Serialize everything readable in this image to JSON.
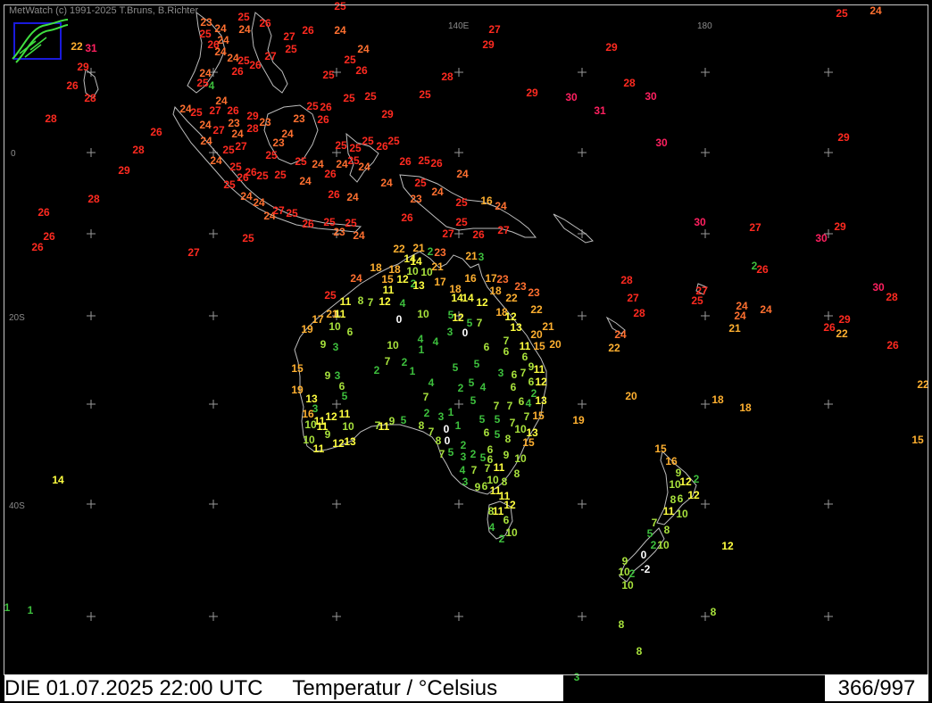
{
  "credit": "MetWatch  (c) 1991-2025 T.Bruns, B.Richter",
  "status": {
    "datetime": "DIE 01.07.2025 22:00 UTC",
    "parameter": "Temperatur / °Celsius",
    "counter": "366/997"
  },
  "graticule_labels": {
    "lon_140": "140E",
    "lon_180": "180",
    "lat_0": "0",
    "lat_20": "20S",
    "lat_40": "40S"
  },
  "colors": {
    "background": "#000000",
    "coast": "#bdbdbd",
    "scale": [
      "#ffffff",
      "#3dbf3d",
      "#a8e23c",
      "#ffff40",
      "#ffb030",
      "#ff7030",
      "#ff2a20",
      "#ff2060"
    ]
  },
  "observations": [
    [
      943,
      15,
      25
    ],
    [
      981,
      12,
      24
    ],
    [
      554,
      33,
      27
    ],
    [
      547,
      50,
      29
    ],
    [
      685,
      53,
      29
    ],
    [
      501,
      86,
      28
    ],
    [
      705,
      93,
      28
    ],
    [
      596,
      104,
      29
    ],
    [
      640,
      109,
      30
    ],
    [
      729,
      108,
      30
    ],
    [
      476,
      106,
      25
    ],
    [
      672,
      124,
      31
    ],
    [
      741,
      160,
      30
    ],
    [
      945,
      154,
      29
    ],
    [
      784,
      249,
      30
    ],
    [
      846,
      255,
      27
    ],
    [
      941,
      254,
      29
    ],
    [
      920,
      267,
      30
    ],
    [
      86,
      52,
      22
    ],
    [
      102,
      54,
      31
    ],
    [
      93,
      75,
      29
    ],
    [
      81,
      96,
      26
    ],
    [
      101,
      110,
      28
    ],
    [
      57,
      133,
      28
    ],
    [
      175,
      148,
      26
    ],
    [
      155,
      168,
      28
    ],
    [
      139,
      191,
      29
    ],
    [
      105,
      223,
      28
    ],
    [
      49,
      238,
      26
    ],
    [
      55,
      265,
      26
    ],
    [
      42,
      277,
      26
    ],
    [
      217,
      283,
      27
    ],
    [
      278,
      267,
      25
    ],
    [
      231,
      25,
      23
    ],
    [
      247,
      32,
      24
    ],
    [
      273,
      19,
      25
    ],
    [
      230,
      38,
      25
    ],
    [
      250,
      45,
      24
    ],
    [
      274,
      33,
      24
    ],
    [
      297,
      26,
      26
    ],
    [
      324,
      41,
      27
    ],
    [
      345,
      34,
      26
    ],
    [
      381,
      34,
      24
    ],
    [
      239,
      50,
      26
    ],
    [
      247,
      58,
      24
    ],
    [
      261,
      65,
      24
    ],
    [
      273,
      68,
      25
    ],
    [
      286,
      73,
      26
    ],
    [
      303,
      63,
      27
    ],
    [
      326,
      55,
      25
    ],
    [
      266,
      80,
      26
    ],
    [
      230,
      82,
      24
    ],
    [
      227,
      93,
      25
    ],
    [
      237,
      96,
      4
    ],
    [
      381,
      7,
      25
    ],
    [
      392,
      67,
      25
    ],
    [
      405,
      79,
      26
    ],
    [
      368,
      84,
      25
    ],
    [
      407,
      55,
      24
    ],
    [
      391,
      110,
      25
    ],
    [
      415,
      108,
      25
    ],
    [
      248,
      113,
      24
    ],
    [
      208,
      122,
      24
    ],
    [
      220,
      126,
      25
    ],
    [
      241,
      124,
      27
    ],
    [
      261,
      124,
      26
    ],
    [
      230,
      140,
      24
    ],
    [
      245,
      146,
      27
    ],
    [
      262,
      138,
      23
    ],
    [
      283,
      130,
      29
    ],
    [
      297,
      137,
      23
    ],
    [
      266,
      150,
      24
    ],
    [
      283,
      144,
      28
    ],
    [
      322,
      150,
      24
    ],
    [
      335,
      133,
      23
    ],
    [
      350,
      119,
      25
    ],
    [
      365,
      120,
      26
    ],
    [
      362,
      134,
      26
    ],
    [
      434,
      128,
      29
    ],
    [
      231,
      158,
      24
    ],
    [
      312,
      160,
      23
    ],
    [
      256,
      168,
      25
    ],
    [
      270,
      164,
      27
    ],
    [
      304,
      174,
      25
    ],
    [
      242,
      180,
      24
    ],
    [
      264,
      187,
      25
    ],
    [
      281,
      193,
      26
    ],
    [
      294,
      197,
      25
    ],
    [
      272,
      199,
      26
    ],
    [
      314,
      196,
      25
    ],
    [
      337,
      181,
      25
    ],
    [
      356,
      184,
      24
    ],
    [
      382,
      163,
      25
    ],
    [
      398,
      166,
      25
    ],
    [
      412,
      158,
      25
    ],
    [
      428,
      164,
      26
    ],
    [
      441,
      158,
      25
    ],
    [
      383,
      184,
      24
    ],
    [
      396,
      180,
      25
    ],
    [
      408,
      187,
      24
    ],
    [
      454,
      181,
      26
    ],
    [
      475,
      180,
      25
    ],
    [
      489,
      183,
      26
    ],
    [
      518,
      195,
      24
    ],
    [
      257,
      207,
      25
    ],
    [
      370,
      195,
      26
    ],
    [
      342,
      203,
      24
    ],
    [
      395,
      221,
      24
    ],
    [
      374,
      218,
      26
    ],
    [
      276,
      220,
      24
    ],
    [
      290,
      227,
      24
    ],
    [
      302,
      242,
      24
    ],
    [
      312,
      236,
      27
    ],
    [
      327,
      239,
      25
    ],
    [
      345,
      251,
      26
    ],
    [
      369,
      249,
      25
    ],
    [
      393,
      250,
      25
    ],
    [
      380,
      260,
      23
    ],
    [
      402,
      264,
      24
    ],
    [
      433,
      205,
      24
    ],
    [
      471,
      205,
      25
    ],
    [
      466,
      223,
      23
    ],
    [
      490,
      215,
      24
    ],
    [
      517,
      227,
      25
    ],
    [
      545,
      225,
      16
    ],
    [
      561,
      231,
      24
    ],
    [
      456,
      244,
      26
    ],
    [
      517,
      249,
      25
    ],
    [
      502,
      262,
      27
    ],
    [
      536,
      263,
      26
    ],
    [
      564,
      258,
      27
    ],
    [
      447,
      279,
      22
    ],
    [
      469,
      278,
      21
    ],
    [
      482,
      282,
      2
    ],
    [
      493,
      283,
      23
    ],
    [
      459,
      290,
      14
    ],
    [
      466,
      293,
      14
    ],
    [
      528,
      287,
      21
    ],
    [
      539,
      288,
      3
    ],
    [
      421,
      300,
      18
    ],
    [
      442,
      302,
      18
    ],
    [
      462,
      304,
      10
    ],
    [
      478,
      305,
      10
    ],
    [
      490,
      299,
      21
    ],
    [
      434,
      313,
      15
    ],
    [
      451,
      313,
      12
    ],
    [
      463,
      318,
      2
    ],
    [
      469,
      320,
      13
    ],
    [
      493,
      316,
      17
    ],
    [
      527,
      312,
      16
    ],
    [
      550,
      312,
      17
    ],
    [
      563,
      313,
      23
    ],
    [
      583,
      321,
      23
    ],
    [
      598,
      328,
      23
    ],
    [
      555,
      326,
      18
    ],
    [
      573,
      334,
      22
    ],
    [
      399,
      312,
      24
    ],
    [
      435,
      325,
      11
    ],
    [
      510,
      324,
      18
    ],
    [
      512,
      334,
      14
    ],
    [
      524,
      334,
      14
    ],
    [
      540,
      339,
      12
    ],
    [
      562,
      350,
      18
    ],
    [
      572,
      355,
      12
    ],
    [
      601,
      347,
      22
    ],
    [
      370,
      331,
      25
    ],
    [
      387,
      338,
      11
    ],
    [
      404,
      337,
      8
    ],
    [
      415,
      339,
      7
    ],
    [
      431,
      338,
      12
    ],
    [
      451,
      340,
      4
    ],
    [
      513,
      356,
      12
    ],
    [
      526,
      362,
      5
    ],
    [
      537,
      362,
      7
    ],
    [
      356,
      358,
      17
    ],
    [
      372,
      352,
      21
    ],
    [
      381,
      352,
      11
    ],
    [
      375,
      366,
      10
    ],
    [
      392,
      372,
      6
    ],
    [
      447,
      358,
      0
    ],
    [
      474,
      352,
      10
    ],
    [
      505,
      353,
      5
    ],
    [
      578,
      367,
      13
    ],
    [
      614,
      366,
      21
    ],
    [
      601,
      375,
      20
    ],
    [
      622,
      386,
      20
    ],
    [
      344,
      369,
      19
    ],
    [
      362,
      386,
      9
    ],
    [
      376,
      389,
      3
    ],
    [
      440,
      387,
      10
    ],
    [
      471,
      380,
      4
    ],
    [
      472,
      392,
      1
    ],
    [
      488,
      383,
      4
    ],
    [
      504,
      372,
      3
    ],
    [
      521,
      373,
      0
    ],
    [
      545,
      389,
      6
    ],
    [
      567,
      382,
      7
    ],
    [
      567,
      394,
      6
    ],
    [
      588,
      388,
      11
    ],
    [
      588,
      400,
      6
    ],
    [
      604,
      388,
      15
    ],
    [
      333,
      413,
      15
    ],
    [
      367,
      421,
      9
    ],
    [
      378,
      421,
      3
    ],
    [
      383,
      433,
      6
    ],
    [
      386,
      444,
      5
    ],
    [
      422,
      415,
      2
    ],
    [
      434,
      405,
      7
    ],
    [
      453,
      406,
      2
    ],
    [
      462,
      416,
      1
    ],
    [
      510,
      412,
      5
    ],
    [
      534,
      408,
      5
    ],
    [
      561,
      418,
      3
    ],
    [
      576,
      420,
      6
    ],
    [
      586,
      418,
      7
    ],
    [
      595,
      411,
      9
    ],
    [
      604,
      414,
      11
    ],
    [
      595,
      428,
      6
    ],
    [
      606,
      428,
      12
    ],
    [
      575,
      434,
      6
    ],
    [
      333,
      437,
      19
    ],
    [
      483,
      429,
      4
    ],
    [
      477,
      445,
      7
    ],
    [
      516,
      435,
      2
    ],
    [
      528,
      429,
      5
    ],
    [
      541,
      434,
      4
    ],
    [
      584,
      450,
      6
    ],
    [
      592,
      452,
      4
    ],
    [
      598,
      441,
      2
    ],
    [
      606,
      449,
      13
    ],
    [
      648,
      471,
      19
    ],
    [
      707,
      444,
      20
    ],
    [
      804,
      448,
      18
    ],
    [
      835,
      457,
      18
    ],
    [
      349,
      447,
      13
    ],
    [
      353,
      458,
      3
    ],
    [
      345,
      464,
      16
    ],
    [
      358,
      472,
      11
    ],
    [
      371,
      467,
      12
    ],
    [
      386,
      464,
      11
    ],
    [
      348,
      476,
      10
    ],
    [
      361,
      478,
      11
    ],
    [
      390,
      478,
      10
    ],
    [
      423,
      477,
      7
    ],
    [
      430,
      478,
      11
    ],
    [
      439,
      472,
      9
    ],
    [
      452,
      471,
      5
    ],
    [
      478,
      463,
      2
    ],
    [
      494,
      467,
      3
    ],
    [
      505,
      462,
      1
    ],
    [
      530,
      449,
      5
    ],
    [
      556,
      455,
      7
    ],
    [
      571,
      455,
      7
    ],
    [
      590,
      467,
      7
    ],
    [
      603,
      466,
      15
    ],
    [
      540,
      470,
      5
    ],
    [
      557,
      470,
      5
    ],
    [
      574,
      474,
      7
    ],
    [
      583,
      481,
      10
    ],
    [
      596,
      485,
      13
    ],
    [
      346,
      493,
      10
    ],
    [
      357,
      503,
      11
    ],
    [
      367,
      487,
      9
    ],
    [
      379,
      497,
      12
    ],
    [
      392,
      495,
      13
    ],
    [
      472,
      477,
      8
    ],
    [
      483,
      484,
      7
    ],
    [
      491,
      494,
      8
    ],
    [
      501,
      494,
      0
    ],
    [
      500,
      481,
      0
    ],
    [
      513,
      477,
      1
    ],
    [
      545,
      485,
      6
    ],
    [
      557,
      487,
      5
    ],
    [
      569,
      492,
      8
    ],
    [
      592,
      496,
      15
    ],
    [
      495,
      509,
      7
    ],
    [
      505,
      507,
      5
    ],
    [
      519,
      512,
      3
    ],
    [
      519,
      499,
      2
    ],
    [
      530,
      509,
      2
    ],
    [
      541,
      513,
      5
    ],
    [
      549,
      504,
      6
    ],
    [
      549,
      515,
      6
    ],
    [
      567,
      510,
      9
    ],
    [
      583,
      514,
      10
    ],
    [
      579,
      531,
      8
    ],
    [
      518,
      527,
      4
    ],
    [
      531,
      527,
      7
    ],
    [
      546,
      525,
      7
    ],
    [
      559,
      524,
      11
    ],
    [
      552,
      538,
      10
    ],
    [
      565,
      540,
      8
    ],
    [
      521,
      540,
      3
    ],
    [
      535,
      546,
      9
    ],
    [
      543,
      545,
      6
    ],
    [
      555,
      550,
      11
    ],
    [
      565,
      556,
      11
    ],
    [
      571,
      566,
      12
    ],
    [
      550,
      573,
      8
    ],
    [
      558,
      573,
      11
    ],
    [
      567,
      583,
      6
    ],
    [
      551,
      591,
      4
    ],
    [
      573,
      597,
      10
    ],
    [
      562,
      604,
      2
    ],
    [
      65,
      538,
      14
    ],
    [
      740,
      503,
      15
    ],
    [
      752,
      517,
      16
    ],
    [
      760,
      530,
      9
    ],
    [
      756,
      543,
      10
    ],
    [
      768,
      540,
      12
    ],
    [
      780,
      537,
      2
    ],
    [
      777,
      555,
      12
    ],
    [
      754,
      560,
      8
    ],
    [
      762,
      559,
      6
    ],
    [
      764,
      576,
      10
    ],
    [
      749,
      573,
      11
    ],
    [
      733,
      586,
      7
    ],
    [
      747,
      594,
      8
    ],
    [
      728,
      598,
      5
    ],
    [
      732,
      611,
      2
    ],
    [
      743,
      611,
      10
    ],
    [
      700,
      629,
      9
    ],
    [
      699,
      641,
      10
    ],
    [
      708,
      643,
      2
    ],
    [
      721,
      622,
      0
    ],
    [
      723,
      638,
      -2
    ],
    [
      703,
      656,
      10
    ],
    [
      815,
      612,
      12
    ],
    [
      1028,
      493,
      15
    ],
    [
      1034,
      431,
      22
    ],
    [
      799,
      686,
      8
    ],
    [
      696,
      700,
      8
    ],
    [
      716,
      730,
      8
    ],
    [
      646,
      759,
      3
    ],
    [
      34,
      684,
      1
    ],
    [
      8,
      681,
      1
    ],
    [
      702,
      314,
      28
    ],
    [
      709,
      334,
      27
    ],
    [
      716,
      351,
      28
    ],
    [
      786,
      326,
      27
    ],
    [
      781,
      337,
      25
    ],
    [
      845,
      298,
      2
    ],
    [
      854,
      302,
      26
    ],
    [
      831,
      343,
      24
    ],
    [
      829,
      354,
      24
    ],
    [
      858,
      347,
      24
    ],
    [
      823,
      368,
      21
    ],
    [
      695,
      375,
      24
    ],
    [
      688,
      390,
      22
    ],
    [
      946,
      358,
      29
    ],
    [
      929,
      367,
      26
    ],
    [
      943,
      374,
      22
    ],
    [
      1000,
      387,
      26
    ],
    [
      984,
      322,
      30
    ],
    [
      999,
      333,
      28
    ]
  ]
}
